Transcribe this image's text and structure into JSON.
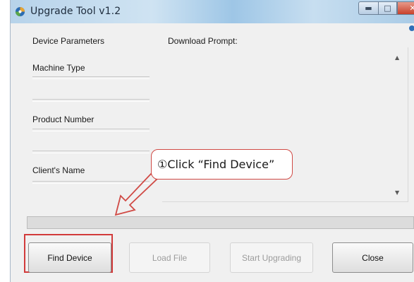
{
  "window": {
    "title": "Upgrade Tool v1.2"
  },
  "left_panel": {
    "section_title": "Device Parameters",
    "fields": [
      {
        "label": "Machine Type"
      },
      {
        "label": "Product Number"
      },
      {
        "label": "Client's Name"
      }
    ]
  },
  "right_panel": {
    "title": "Download Prompt:"
  },
  "buttons": {
    "find_device": "Find Device",
    "load_file": "Load File",
    "start_upgrading": "Start Upgrading",
    "close": "Close"
  },
  "annotation": {
    "callout_text": "①Click “Find Device”"
  },
  "colors": {
    "highlight": "#d23b3b",
    "callout_border": "#d04a45"
  }
}
